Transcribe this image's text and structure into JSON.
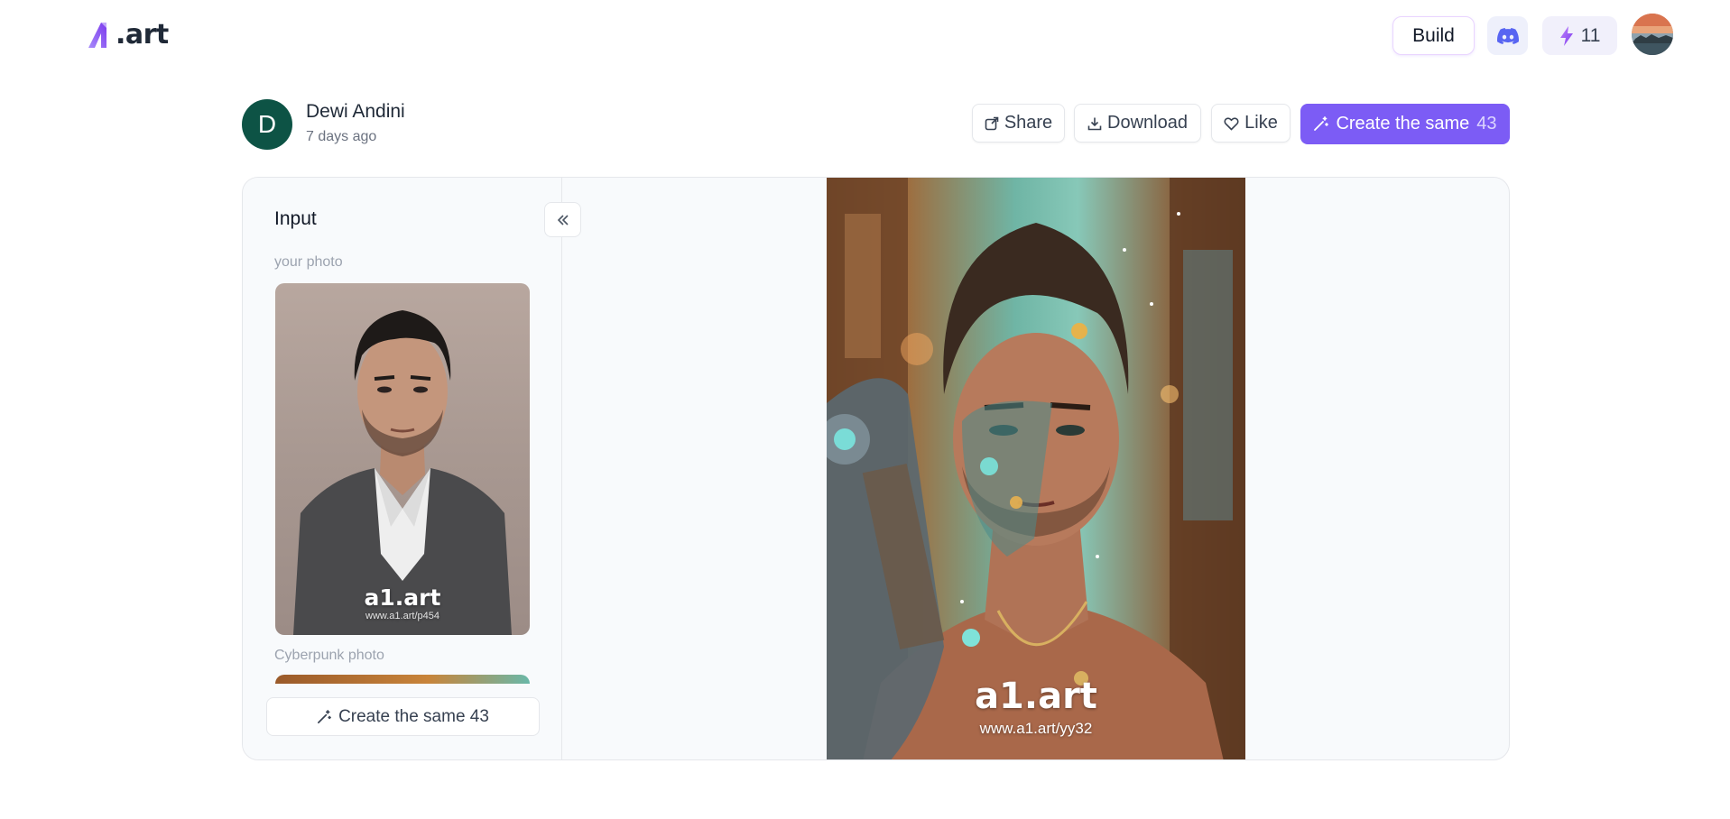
{
  "header": {
    "logo_text": ".art",
    "build_label": "Build",
    "credits": "11",
    "brand_color": "#7c5cf5"
  },
  "author": {
    "initial": "D",
    "name": "Dewi Andini",
    "time": "7 days ago",
    "avatar_color": "#0d5345"
  },
  "actions": {
    "share_label": "Share",
    "download_label": "Download",
    "like_label": "Like",
    "create_label": "Create the same",
    "create_count": "43"
  },
  "input_panel": {
    "title": "Input",
    "photo_label": "your photo",
    "photo_watermark": "a1.art",
    "photo_watermark_url": "www.a1.art/p454",
    "cyberpunk_label": "Cyberpunk photo",
    "create_label": "Create the same 43"
  },
  "result": {
    "watermark": "a1.art",
    "watermark_url": "www.a1.art/yy32"
  }
}
